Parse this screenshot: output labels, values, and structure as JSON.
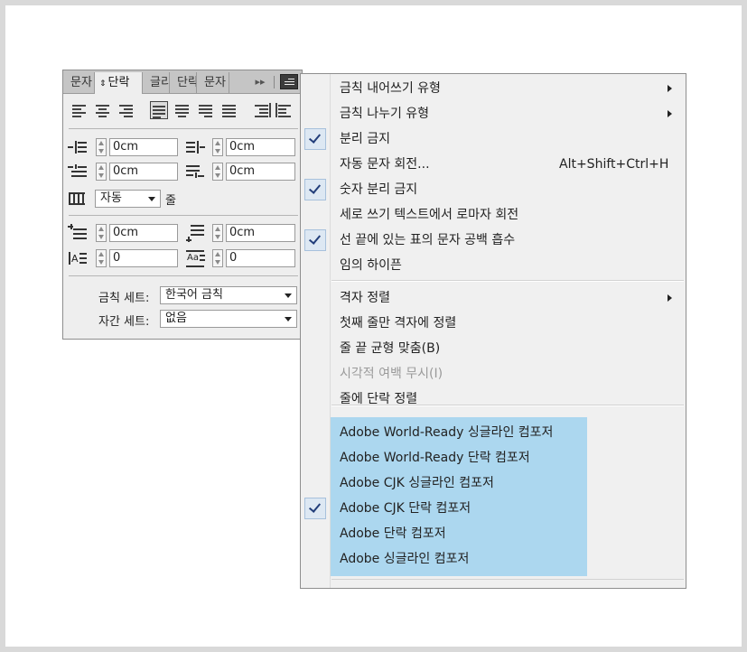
{
  "panel": {
    "tabs": [
      {
        "label": "문자",
        "active": false
      },
      {
        "label": "단락",
        "active": true
      },
      {
        "label": "글리프",
        "active": false
      },
      {
        "label": "단락",
        "active": false
      },
      {
        "label": "문자",
        "active": false
      }
    ],
    "active_tab_arrows": "⇕",
    "forward_icon": "▸▸",
    "fields": {
      "left_indent": "0cm",
      "right_indent": "0cm",
      "first_line_indent": "0cm",
      "last_line_indent": "0cm",
      "space_before": "0cm",
      "space_after": "0cm",
      "drop_cap_lines": "0",
      "drop_cap_chars": "0"
    },
    "hyphen_zone": {
      "value": "자동",
      "suffix": "줄"
    },
    "kinsoku_label": "금칙 세트:",
    "kinsoku_value": "한국어 금칙",
    "mojikumi_label": "자간 세트:",
    "mojikumi_value": "없음"
  },
  "menu": {
    "items": [
      {
        "label": "금칙 내어쓰기 유형",
        "submenu": true,
        "checked": false
      },
      {
        "label": "금칙 나누기 유형",
        "submenu": true,
        "checked": false
      },
      {
        "label": "분리 금지",
        "checked": true
      },
      {
        "label": "자동 문자 회전...",
        "shortcut": "Alt+Shift+Ctrl+H",
        "checked": false
      },
      {
        "label": "숫자 분리 금지",
        "checked": true
      },
      {
        "label": "세로 쓰기 텍스트에서 로마자 회전",
        "checked": false
      },
      {
        "label": "선 끝에 있는 표의 문자 공백 흡수",
        "checked": true
      },
      {
        "label": "임의 하이픈",
        "checked": false
      },
      {
        "label": "격자 정렬",
        "submenu": true,
        "checked": false
      },
      {
        "label": "첫째 줄만 격자에 정렬",
        "checked": false
      },
      {
        "label": "줄 끝 균형 맞춤(B)",
        "checked": false
      },
      {
        "label": "시각적 여백 무시(I)",
        "disabled": true,
        "checked": false
      },
      {
        "label": "줄에 단락 정렬",
        "checked": false
      },
      {
        "label": "Adobe World-Ready 싱글라인 컴포저",
        "checked": false
      },
      {
        "label": "Adobe World-Ready 단락 컴포저",
        "checked": false
      },
      {
        "label": "Adobe CJK 싱글라인 컴포저",
        "checked": false
      },
      {
        "label": "Adobe CJK 단락 컴포저",
        "checked": true
      },
      {
        "label": "Adobe 단락 컴포저",
        "checked": false
      },
      {
        "label": "Adobe 싱글라인 컴포저",
        "checked": false
      }
    ],
    "highlight_color": "#acd7ef"
  }
}
